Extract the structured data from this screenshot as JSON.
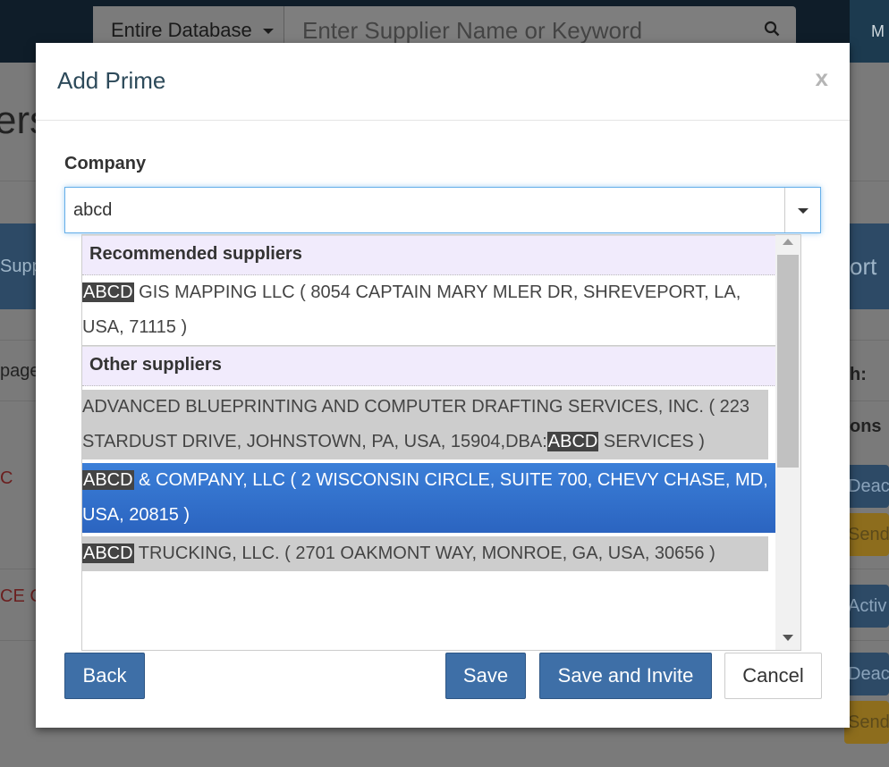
{
  "background": {
    "scope_label": "Entire Database",
    "search_placeholder": "Enter Supplier Name or Keyword",
    "top_right": "M",
    "page_title_fragment": "ers",
    "band_left": "Supp",
    "band_right": "ort",
    "left_frag_1": "page",
    "left_frag_2": "C",
    "left_frag_3": "CE C",
    "right_search_frag": "h:",
    "right_col_frag": "ons",
    "right_buttons": [
      "Deact",
      "Send",
      "Activ",
      "Deact",
      "Send"
    ]
  },
  "modal": {
    "title": "Add Prime",
    "close_label": "x",
    "company_label": "Company",
    "company_input_value": "abcd",
    "groups": {
      "recommended": "Recommended suppliers",
      "other": "Other suppliers"
    },
    "highlight": "ABCD",
    "options": {
      "rec1": {
        "pre": "",
        "post": " GIS MAPPING LLC ( 8054 CAPTAIN MARY MLER DR, SHREVEPORT, LA, USA, 71115 )"
      },
      "oth1": {
        "pre": "ADVANCED BLUEPRINTING AND COMPUTER DRAFTING SERVICES, INC. ( 223 STARDUST DRIVE, JOHNSTOWN, PA, USA, 15904,DBA:",
        "post": " SERVICES )"
      },
      "oth2": {
        "pre": "",
        "post": " & COMPANY, LLC ( 2 WISCONSIN CIRCLE, SUITE 700, CHEVY CHASE, MD, USA, 20815 )"
      },
      "oth3": {
        "pre": "",
        "post": " TRUCKING, LLC. ( 2701 OAKMONT WAY, MONROE, GA, USA, 30656 )"
      }
    },
    "buttons": {
      "back": "Back",
      "save": "Save",
      "save_invite": "Save and Invite",
      "cancel": "Cancel"
    }
  },
  "colors": {
    "primary": "#3e6fa7",
    "active_option": "#2b64c0",
    "group_header_bg": "#f1ebfc"
  }
}
